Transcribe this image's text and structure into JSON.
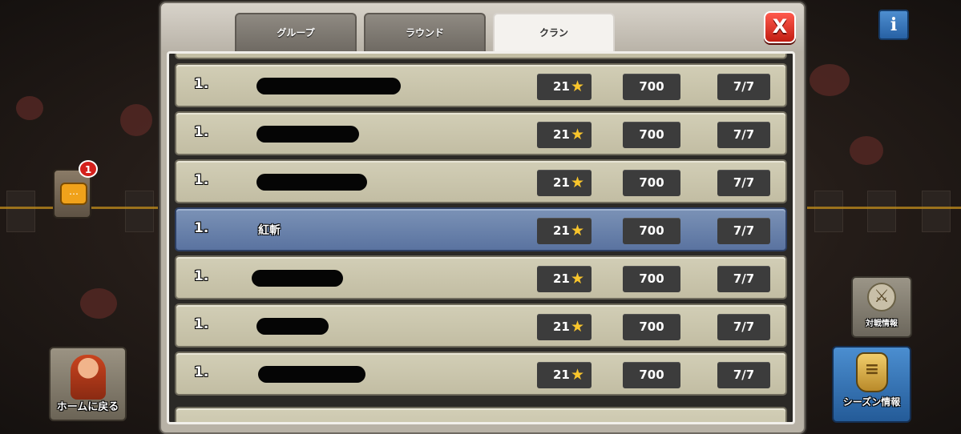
{
  "tabs": [
    {
      "label": "グループ",
      "active": false
    },
    {
      "label": "ラウンド",
      "active": false
    },
    {
      "label": "クラン",
      "active": true
    }
  ],
  "close_label": "X",
  "rows": [
    {
      "rank": "1.",
      "name": "",
      "stars": "21",
      "percent": "700",
      "attacks": "7/7",
      "highlighted": false
    },
    {
      "rank": "1.",
      "name": "",
      "stars": "21",
      "percent": "700",
      "attacks": "7/7",
      "highlighted": false
    },
    {
      "rank": "1.",
      "name": "",
      "stars": "21",
      "percent": "700",
      "attacks": "7/7",
      "highlighted": false
    },
    {
      "rank": "1.",
      "name": "紅斬",
      "stars": "21",
      "percent": "700",
      "attacks": "7/7",
      "highlighted": true
    },
    {
      "rank": "1.",
      "name": "",
      "stars": "21",
      "percent": "700",
      "attacks": "7/7",
      "highlighted": false
    },
    {
      "rank": "1.",
      "name": "",
      "stars": "21",
      "percent": "700",
      "attacks": "7/7",
      "highlighted": false
    },
    {
      "rank": "1.",
      "name": "",
      "stars": "21",
      "percent": "700",
      "attacks": "7/7",
      "highlighted": false
    }
  ],
  "side": {
    "chat_badge": "1",
    "home_label": "ホームに戻る",
    "info_label": "i",
    "warlog_label": "対戦情報",
    "season_label": "シーズン情報"
  },
  "colors": {
    "row_bg": "#c8c3aa",
    "row_highlight": "#6a82ac",
    "star": "#f8c52c",
    "close": "#d9281c",
    "season": "#3a78be"
  },
  "icons": [
    "star-icon",
    "close-icon",
    "chat-icon",
    "info-icon",
    "war-log-icon",
    "trophy-icon",
    "villager-icon"
  ]
}
